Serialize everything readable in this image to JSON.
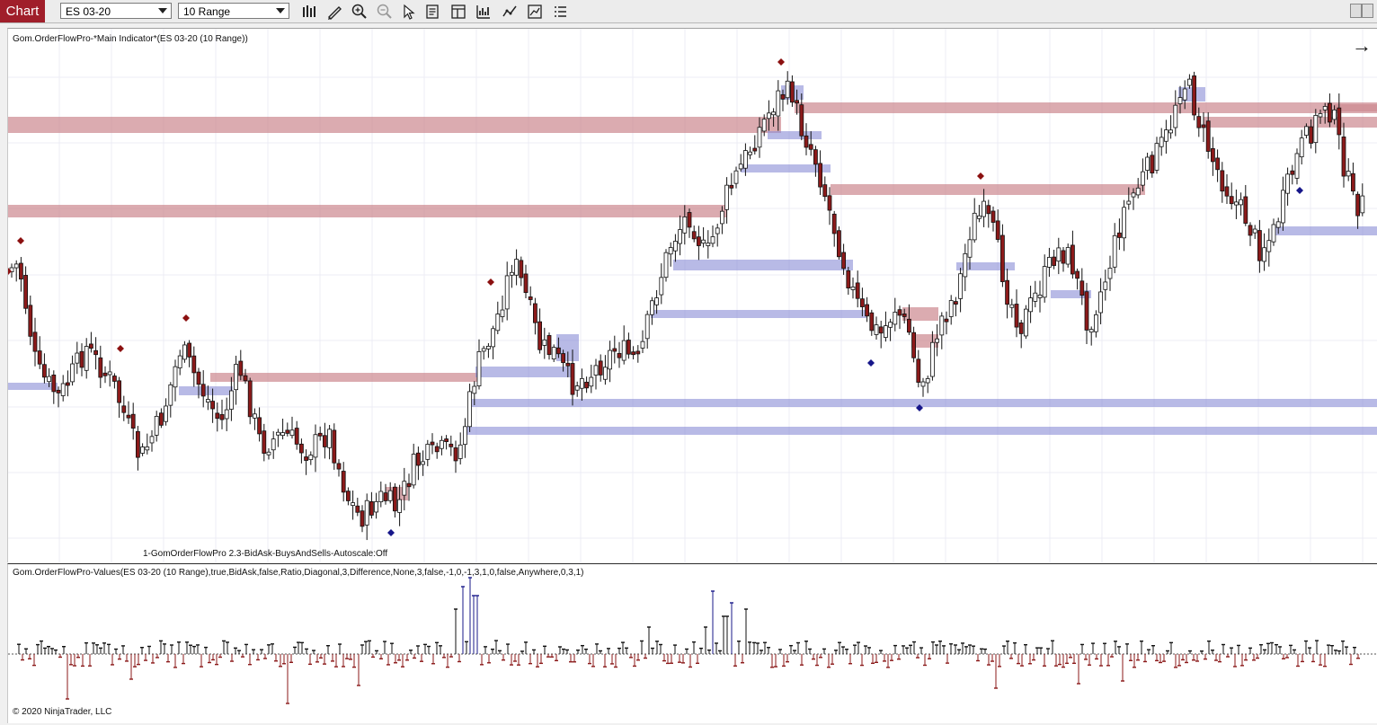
{
  "toolbar": {
    "chart_tab": "Chart",
    "instrument": "ES 03-20",
    "bar_type": "10 Range",
    "icons": [
      "bar-style-icon",
      "draw-tool-icon",
      "zoom-in-icon",
      "zoom-out-icon",
      "pointer-icon",
      "data-box-icon",
      "templates-icon",
      "chart-trader-icon",
      "indicators-icon",
      "strategies-icon",
      "properties-icon"
    ]
  },
  "price_panel": {
    "title": "Gom.OrderFlowPro-*Main Indicator*(ES 03-20 (10 Range))",
    "footer_label": "1-GomOrderFlowPro 2.3-BidAsk-BuysAndSells-Autoscale:Off",
    "arrow_glyph": "→"
  },
  "values_panel": {
    "title": "Gom.OrderFlowPro-Values(ES 03-20 (10 Range),true,BidAsk,false,Ratio,Diagonal,3,Difference,None,3,false,-1,0,-1,3,1,0,false,Anywhere,0,3,1)"
  },
  "copyright": "© 2020 NinjaTrader, LLC",
  "colors": {
    "bull_candle": "#ffffff",
    "bear_candle": "#8b1a1a",
    "ask_zone": "#cd8a92",
    "bid_zone": "#8c8fd6",
    "diamond_high": "#8b1010",
    "diamond_low": "#16168a",
    "hist_pos": "#111111",
    "hist_neg": "#8b1a1a",
    "hist_spike": "#1a1a8a",
    "chart_tab": "#a01e2a"
  }
}
